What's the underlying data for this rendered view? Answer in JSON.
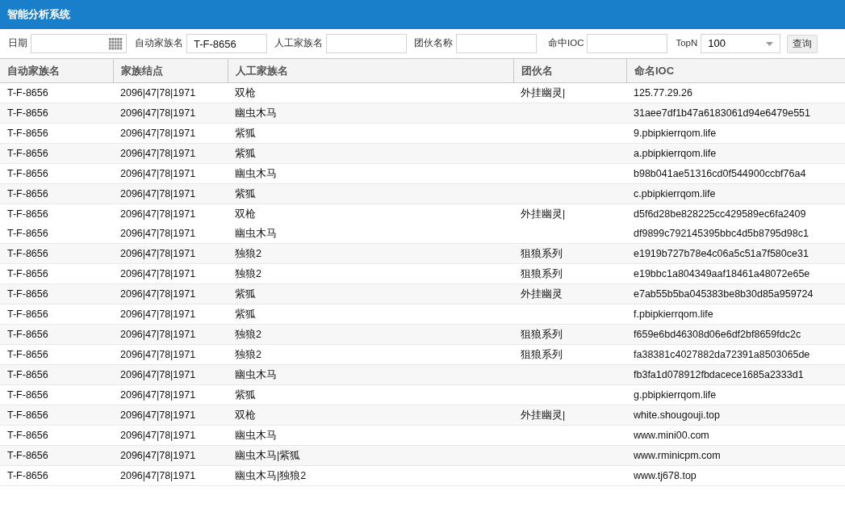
{
  "app_title": "智能分析系统",
  "filters": [
    {
      "kind": "date",
      "label": "日期"
    },
    {
      "kind": "text",
      "label": "自动家族名",
      "value": "T-F-8656"
    },
    {
      "kind": "text",
      "label": "人工家族名"
    },
    {
      "kind": "text",
      "label": "团伙名称"
    },
    {
      "kind": "text",
      "label": "命中IOC"
    },
    {
      "kind": "select",
      "label": "TopN",
      "value": "100"
    }
  ],
  "query_button": "查询",
  "table": {
    "columns": [
      "自动家族名",
      "家族结点",
      "人工家族名",
      "团伙名",
      "命名IOC"
    ],
    "rows": [
      {
        "lines": [
          {
            "auto_family": "T-F-8656",
            "node": "2096|47|78|1971",
            "manual_family": "双枪",
            "gang": "外挂幽灵|",
            "ioc": "125.77.29.26"
          }
        ]
      },
      {
        "lines": [
          {
            "auto_family": "T-F-8656",
            "node": "2096|47|78|1971",
            "manual_family": "幽虫木马",
            "ioc": "31aee7df1b47a6183061d94e6479e551"
          }
        ]
      },
      {
        "lines": [
          {
            "auto_family": "T-F-8656",
            "node": "2096|47|78|1971",
            "manual_family": "紫狐",
            "ioc": "9.pbipkierrqom.life"
          }
        ]
      },
      {
        "lines": [
          {
            "auto_family": "T-F-8656",
            "node": "2096|47|78|1971",
            "manual_family": "紫狐",
            "ioc": "a.pbipkierrqom.life"
          }
        ]
      },
      {
        "lines": [
          {
            "auto_family": "T-F-8656",
            "node": "2096|47|78|1971",
            "manual_family": "幽虫木马",
            "ioc": "b98b041ae51316cd0f544900ccbf76a4"
          }
        ]
      },
      {
        "lines": [
          {
            "auto_family": "T-F-8656",
            "node": "2096|47|78|1971",
            "manual_family": "紫狐",
            "ioc": "c.pbipkierrqom.life"
          }
        ]
      },
      {
        "lines": [
          {
            "auto_family": "T-F-8656",
            "node": "2096|47|78|1971",
            "manual_family": "双枪",
            "gang": "外挂幽灵|",
            "ioc": "d5f6d28be828225cc429589ec6fa2409"
          },
          {
            "auto_family": "T-F-8656",
            "node": "2096|47|78|1971",
            "manual_family": "幽虫木马",
            "ioc": "df9899c792145395bbc4d5b8795d98c1"
          }
        ]
      },
      {
        "lines": [
          {
            "auto_family": "T-F-8656",
            "node": "2096|47|78|1971",
            "manual_family": "独狼2",
            "gang": "狙狼系列",
            "ioc": "e1919b727b78e4c06a5c51a7f580ce31"
          }
        ]
      },
      {
        "lines": [
          {
            "auto_family": "T-F-8656",
            "node": "2096|47|78|1971",
            "manual_family": "独狼2",
            "gang": "狙狼系列",
            "ioc": "e19bbc1a804349aaf18461a48072e65e"
          }
        ]
      },
      {
        "lines": [
          {
            "auto_family": "T-F-8656",
            "node": "2096|47|78|1971",
            "manual_family": "紫狐",
            "gang": "外挂幽灵",
            "ioc": "e7ab55b5ba045383be8b30d85a959724"
          }
        ]
      },
      {
        "lines": [
          {
            "auto_family": "T-F-8656",
            "node": "2096|47|78|1971",
            "manual_family": "紫狐",
            "ioc": "f.pbipkierrqom.life"
          }
        ]
      },
      {
        "lines": [
          {
            "auto_family": "T-F-8656",
            "node": "2096|47|78|1971",
            "manual_family": "独狼2",
            "gang": "狙狼系列",
            "ioc": "f659e6bd46308d06e6df2bf8659fdc2c"
          }
        ]
      },
      {
        "lines": [
          {
            "auto_family": "T-F-8656",
            "node": "2096|47|78|1971",
            "manual_family": "独狼2",
            "gang": "狙狼系列",
            "ioc": "fa38381c4027882da72391a8503065de"
          }
        ]
      },
      {
        "lines": [
          {
            "auto_family": "T-F-8656",
            "node": "2096|47|78|1971",
            "manual_family": "幽虫木马",
            "ioc": "fb3fa1d078912fbdacece1685a2333d1"
          }
        ]
      },
      {
        "lines": [
          {
            "auto_family": "T-F-8656",
            "node": "2096|47|78|1971",
            "manual_family": "紫狐",
            "ioc": "g.pbipkierrqom.life"
          }
        ]
      },
      {
        "lines": [
          {
            "auto_family": "T-F-8656",
            "node": "2096|47|78|1971",
            "manual_family": "双枪",
            "gang": "外挂幽灵|",
            "ioc": "white.shougouji.top"
          }
        ]
      },
      {
        "lines": [
          {
            "auto_family": "T-F-8656",
            "node": "2096|47|78|1971",
            "manual_family": "幽虫木马",
            "ioc": "www.mini00.com"
          }
        ]
      },
      {
        "lines": [
          {
            "auto_family": "T-F-8656",
            "node": "2096|47|78|1971",
            "manual_family": "幽虫木马|紫狐",
            "ioc": "www.rminicpm.com"
          }
        ]
      },
      {
        "lines": [
          {
            "auto_family": "T-F-8656",
            "node": "2096|47|78|1971",
            "manual_family": "幽虫木马|独狼2",
            "ioc": "www.tj678.top"
          }
        ]
      }
    ]
  }
}
